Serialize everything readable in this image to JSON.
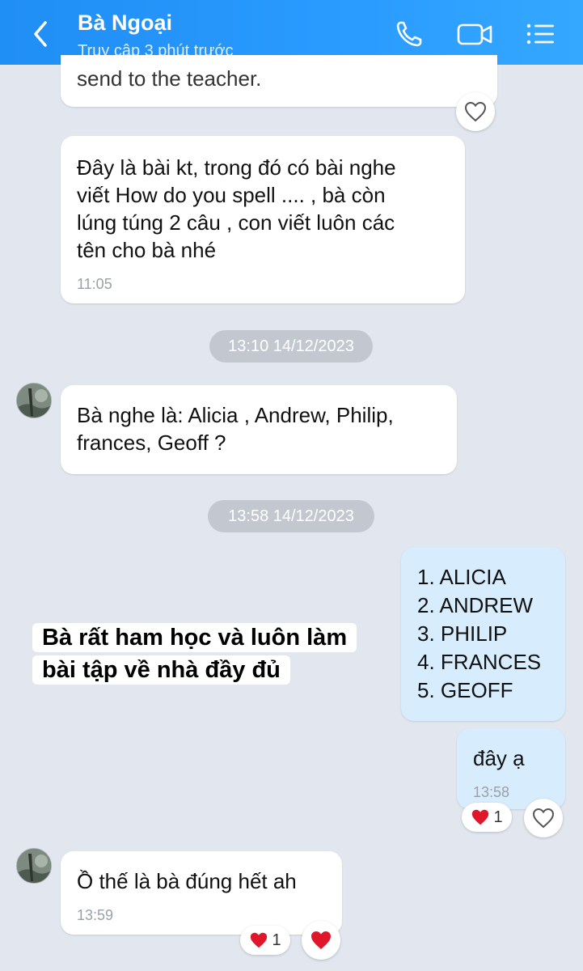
{
  "header": {
    "title": "Bà Ngoại",
    "subtitle": "Truy cập 3 phút trước",
    "back_icon": "chevron-left-icon",
    "call_icon": "phone-icon",
    "video_icon": "video-camera-icon",
    "menu_icon": "list-menu-icon",
    "bg_color": "#1f8ef5"
  },
  "messages": {
    "m0": {
      "text": "send to the teacher."
    },
    "m1": {
      "text": "Đây là bài kt, trong đó có bài nghe\nviết How do you spell .... , bà còn\nlúng túng 2 câu , con viết luôn các\ntên cho bà nhé",
      "time": "11:05"
    },
    "sep1": "13:10 14/12/2023",
    "m2": {
      "text": "Bà nghe là: Alicia , Andrew, Philip,\nfrances, Geoff ?"
    },
    "sep2": "13:58 14/12/2023",
    "m3": {
      "text": "1. ALICIA\n2. ANDREW\n3. PHILIP\n4. FRANCES\n5. GEOFF"
    },
    "m4": {
      "text": "đây ạ",
      "time": "13:58",
      "reaction_count": "1"
    },
    "m5": {
      "text": "Ồ thế là bà đúng hết ah",
      "time": "13:59",
      "reaction_count": "1"
    }
  },
  "caption": {
    "text": "Bà rất ham học và luôn làm\nbài tập về nhà đầy đủ"
  },
  "colors": {
    "heart": "#e0162b",
    "outgoing_bubble": "#d7ecfd",
    "background": "#e2e6ee"
  }
}
